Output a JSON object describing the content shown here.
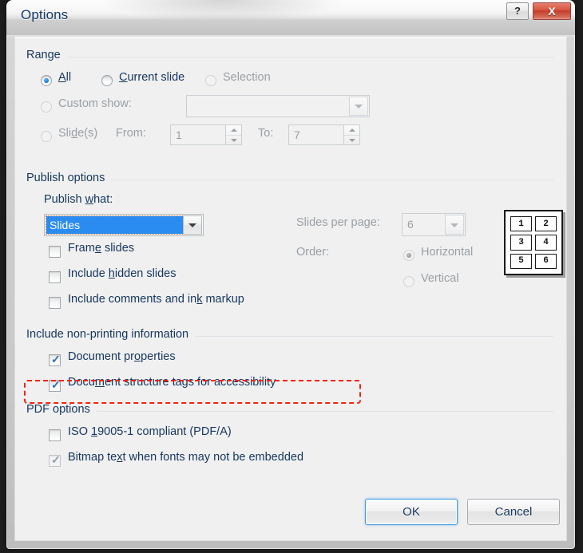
{
  "window": {
    "title": "Options",
    "help_label": "?",
    "close_label": "X"
  },
  "range": {
    "group_label": "Range",
    "options": [
      {
        "label": "All",
        "accel": "A",
        "selected": true,
        "disabled": false
      },
      {
        "label": "Current slide",
        "accel": "C",
        "selected": false,
        "disabled": false
      },
      {
        "label": "Selection",
        "accel": "S",
        "selected": false,
        "disabled": true
      },
      {
        "label": "Custom show:",
        "accel": "",
        "selected": false,
        "disabled": true
      },
      {
        "label": "Slide(s)",
        "accel": "d",
        "selected": false,
        "disabled": true
      }
    ],
    "custom_show_value": "",
    "from_label": "From:",
    "from_value": "1",
    "to_label": "To:",
    "to_value": "7"
  },
  "publish": {
    "group_label": "Publish options",
    "publish_what_label": "Publish what:",
    "publish_what_value": "Slides",
    "checkboxes": [
      {
        "label": "Frame slides",
        "checked": false,
        "disabled": false
      },
      {
        "label": "Include hidden slides",
        "checked": false,
        "disabled": false
      },
      {
        "label": "Include comments and ink markup",
        "checked": false,
        "disabled": false
      }
    ],
    "slides_per_page_label": "Slides per page:",
    "slides_per_page_value": "6",
    "order_label": "Order:",
    "order_options": [
      {
        "label": "Horizontal",
        "selected": true,
        "disabled": true
      },
      {
        "label": "Vertical",
        "selected": false,
        "disabled": true
      }
    ],
    "preview_cells": [
      "1",
      "2",
      "3",
      "4",
      "5",
      "6"
    ]
  },
  "nonprinting": {
    "group_label": "Include non-printing information",
    "checkboxes": [
      {
        "label": "Document properties",
        "checked": true,
        "disabled": false
      },
      {
        "label": "Document structure tags for accessibility",
        "checked": true,
        "disabled": false
      }
    ]
  },
  "pdf": {
    "group_label": "PDF options",
    "checkboxes": [
      {
        "label": "ISO 19005-1 compliant (PDF/A)",
        "checked": false,
        "disabled": false
      },
      {
        "label": "Bitmap text when fonts may not be embedded",
        "checked": true,
        "disabled": true
      }
    ]
  },
  "footer": {
    "ok_label": "OK",
    "cancel_label": "Cancel"
  },
  "annotation": {
    "color": "#f02511",
    "target": "Document structure tags for accessibility"
  }
}
